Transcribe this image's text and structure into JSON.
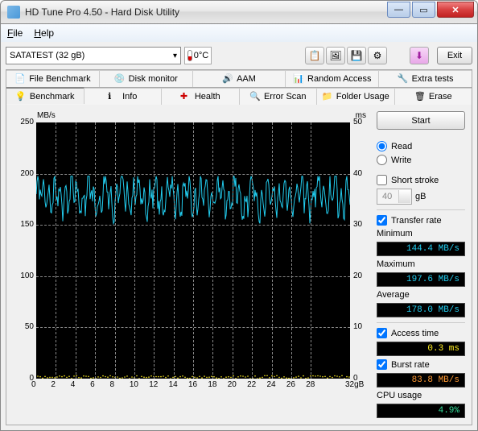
{
  "window": {
    "title": "HD Tune Pro 4.50 - Hard Disk Utility"
  },
  "menu": {
    "file": "File",
    "help": "Help"
  },
  "toolbar": {
    "drive": "SATATEST (32 gB)",
    "temp": "0°C",
    "exit": "Exit"
  },
  "tabs_row1": {
    "file_benchmark": "File Benchmark",
    "disk_monitor": "Disk monitor",
    "aam": "AAM",
    "random_access": "Random Access",
    "extra_tests": "Extra tests"
  },
  "tabs_row2": {
    "benchmark": "Benchmark",
    "info": "Info",
    "health": "Health",
    "error_scan": "Error Scan",
    "folder_usage": "Folder Usage",
    "erase": "Erase"
  },
  "side": {
    "start": "Start",
    "read": "Read",
    "write": "Write",
    "short_stroke": "Short stroke",
    "short_stroke_val": "40",
    "short_stroke_unit": "gB",
    "transfer_rate": "Transfer rate",
    "minimum_label": "Minimum",
    "minimum_val": "144.4 MB/s",
    "maximum_label": "Maximum",
    "maximum_val": "197.6 MB/s",
    "average_label": "Average",
    "average_val": "178.0 MB/s",
    "access_time_label": "Access time",
    "access_time_val": "0.3 ms",
    "burst_rate_label": "Burst rate",
    "burst_rate_val": "83.8 MB/s",
    "cpu_usage_label": "CPU usage",
    "cpu_usage_val": "4.9%"
  },
  "chart_data": {
    "type": "line",
    "xlabel": "gB",
    "x_range": [
      0,
      32
    ],
    "x_ticks": [
      0,
      2,
      4,
      6,
      8,
      10,
      12,
      14,
      16,
      18,
      20,
      22,
      24,
      26,
      28,
      "32gB"
    ],
    "y_left_label": "MB/s",
    "y_left_range": [
      0,
      250
    ],
    "y_left_ticks": [
      0,
      50,
      100,
      150,
      200,
      250
    ],
    "y_right_label": "ms",
    "y_right_range": [
      0,
      50
    ],
    "y_right_ticks": [
      0,
      10,
      20,
      30,
      40,
      50
    ],
    "series": [
      {
        "name": "transfer_rate",
        "axis": "left",
        "color": "#22ccee",
        "approx_min": 144.4,
        "approx_max": 197.6,
        "approx_avg": 178.0,
        "note": "noisy oscillation across full x range"
      },
      {
        "name": "access_time",
        "axis": "right",
        "color": "#ffee22",
        "approx_value": 0.3,
        "note": "scattered dots near bottom across full x range"
      }
    ]
  }
}
